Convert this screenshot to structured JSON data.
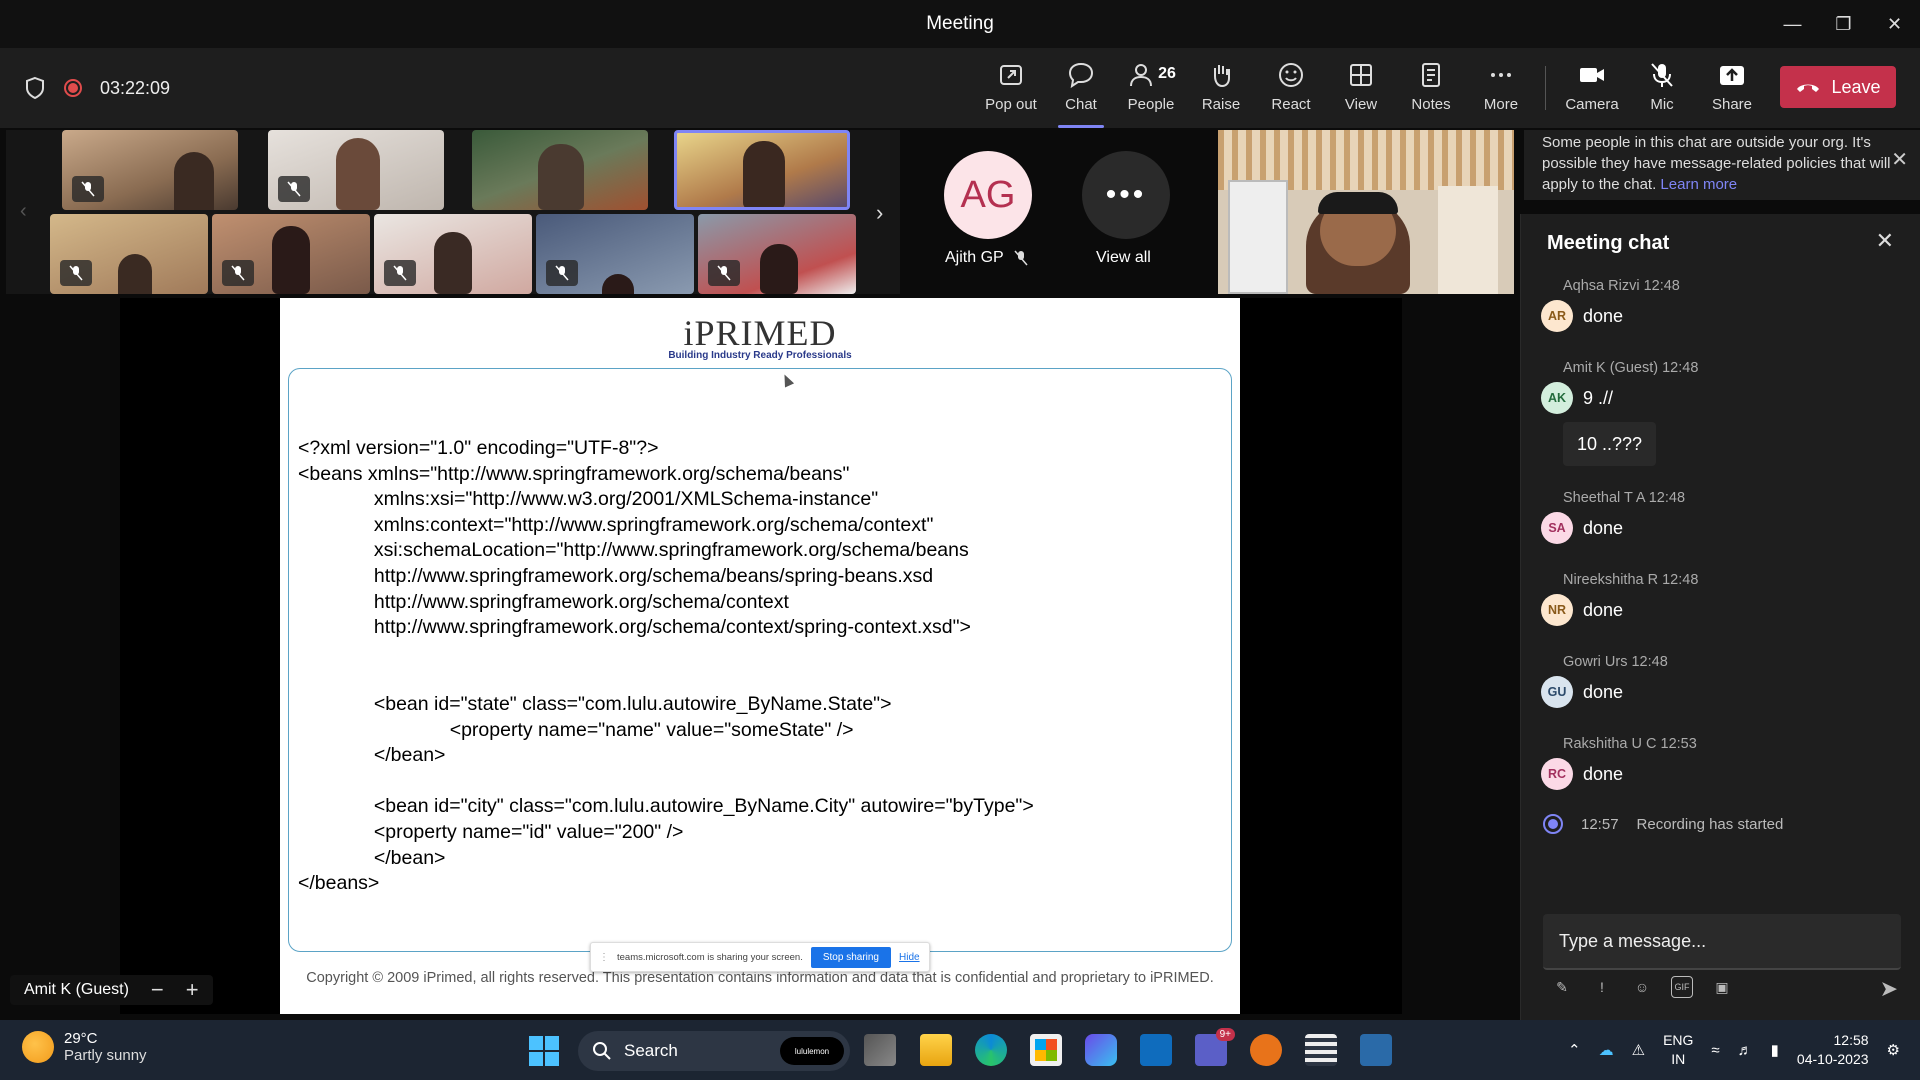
{
  "window": {
    "title": "Meeting"
  },
  "toolbar": {
    "timer": "03:22:09",
    "popout": "Pop out",
    "chat": "Chat",
    "people": "People",
    "people_count": "26",
    "raise": "Raise",
    "react": "React",
    "view": "View",
    "notes": "Notes",
    "more": "More",
    "camera": "Camera",
    "mic": "Mic",
    "share": "Share",
    "leave": "Leave"
  },
  "participants": {
    "featured_initials": "AG",
    "featured_name": "Ajith GP",
    "view_all": "View all"
  },
  "slide": {
    "brand": "iPRIMED",
    "tagline": "Building Industry Ready Professionals",
    "code": "<?xml version=\"1.0\" encoding=\"UTF-8\"?>\n<beans xmlns=\"http://www.springframework.org/schema/beans\"\n              xmlns:xsi=\"http://www.w3.org/2001/XMLSchema-instance\"\n              xmlns:context=\"http://www.springframework.org/schema/context\"\n              xsi:schemaLocation=\"http://www.springframework.org/schema/beans\n              http://www.springframework.org/schema/beans/spring-beans.xsd\n              http://www.springframework.org/schema/context\n              http://www.springframework.org/schema/context/spring-context.xsd\">\n\n\n              <bean id=\"state\" class=\"com.lulu.autowire_ByName.State\">\n                            <property name=\"name\" value=\"someState\" />\n              </bean>\n\n              <bean id=\"city\" class=\"com.lulu.autowire_ByName.City\" autowire=\"byType\">\n              <property name=\"id\" value=\"200\" />\n              </bean>\n</beans>",
    "footer": "Copyright © 2009 iPrimed, all rights reserved. This presentation contains information  and data  that is confidential and proprietary to iPRIMED."
  },
  "share_bar": {
    "message": "teams.microsoft.com is sharing your screen.",
    "stop": "Stop sharing",
    "hide": "Hide"
  },
  "presenter": {
    "name": "Amit K (Guest)",
    "zoom_out": "−",
    "zoom_in": "+"
  },
  "notice": {
    "text": "Some people in this chat are outside your org. It's possible they have message-related policies that will apply to the chat.",
    "link": "Learn more"
  },
  "chat": {
    "title": "Meeting chat",
    "messages": [
      {
        "initials": "AR",
        "head": "Aqhsa Rizvi  12:48",
        "text": "done",
        "color": "#fde7cf",
        "fg": "#8a5a1a"
      },
      {
        "initials": "AK",
        "head": "Amit K (Guest)  12:48",
        "text": "9 .//",
        "text2": "10 ..???",
        "color": "#d3eedd",
        "fg": "#236b3c"
      },
      {
        "initials": "SA",
        "head": "Sheethal T A  12:48",
        "text": "done",
        "color": "#fbd9e6",
        "fg": "#a2305e"
      },
      {
        "initials": "NR",
        "head": "Nireekshitha R  12:48",
        "text": "done",
        "color": "#fde7cf",
        "fg": "#8a5a1a"
      },
      {
        "initials": "GU",
        "head": "Gowri Urs  12:48",
        "text": "done",
        "color": "#d9e4ee",
        "fg": "#2c4a6a"
      },
      {
        "initials": "RC",
        "head": "Rakshitha U C  12:53",
        "text": "done",
        "color": "#fbd9e6",
        "fg": "#a2305e"
      }
    ],
    "system": {
      "time": "12:57",
      "text": "Recording has started"
    },
    "compose_placeholder": "Type a message..."
  },
  "taskbar": {
    "temp": "29°C",
    "weather": "Partly sunny",
    "search": "Search",
    "search_pill": "lululemon",
    "teams_badge": "9+",
    "lang1": "ENG",
    "lang2": "IN",
    "time": "12:58",
    "date": "04-10-2023"
  }
}
